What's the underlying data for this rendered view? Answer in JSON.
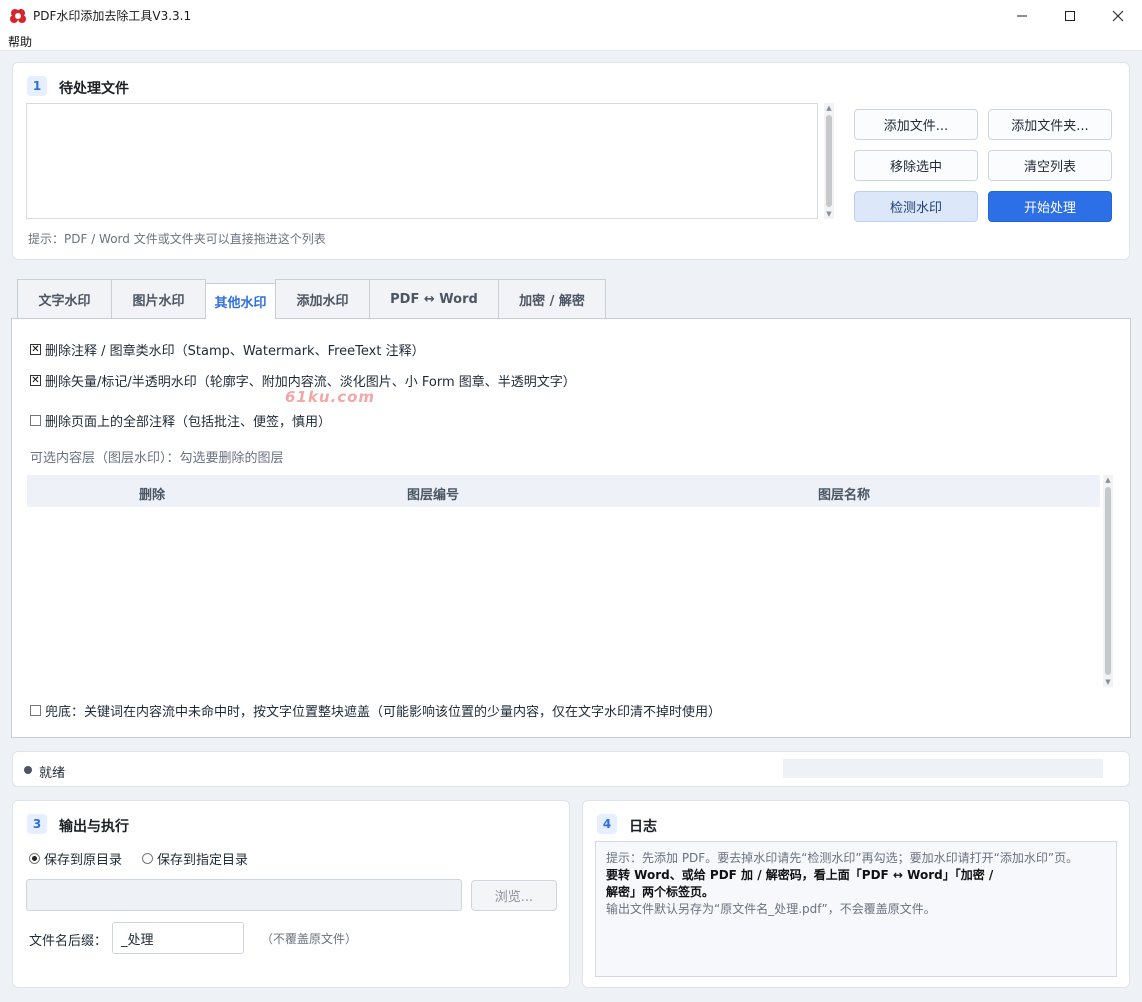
{
  "window": {
    "title": "PDF水印添加去除工具V3.3.1",
    "minimize": "—",
    "maximize": "☐",
    "close": "✕"
  },
  "menu": {
    "help": "帮助"
  },
  "files_section": {
    "number": "1",
    "title": "待处理文件",
    "hint": "提示：PDF / Word 文件或文件夹可以直接拖进这个列表",
    "buttons": {
      "add_file": "添加文件...",
      "add_folder": "添加文件夹...",
      "remove_selected": "移除选中",
      "clear_list": "清空列表",
      "detect_watermark": "检测水印",
      "start": "开始处理"
    }
  },
  "tabs": [
    "文字水印",
    "图片水印",
    "其他水印",
    "添加水印",
    "PDF ↔ Word",
    "加密 / 解密"
  ],
  "active_tab": 2,
  "other_watermark": {
    "opt_annotations": "删除注释 / 图章类水印（Stamp、Watermark、FreeText 注释）",
    "opt_annotations_checked": true,
    "opt_vector": "删除矢量/标记/半透明水印（轮廓字、附加内容流、淡化图片、小 Form 图章、半透明文字）",
    "opt_vector_checked": true,
    "opt_all_annots": "删除页面上的全部注释（包括批注、便签，慎用）",
    "opt_all_annots_checked": false,
    "layers_label": "可选内容层（图层水印）：勾选要删除的图层",
    "columns": [
      "删除",
      "图层编号",
      "图层名称"
    ],
    "rows": [],
    "fallback": "兜底：关键词在内容流中未命中时，按文字位置整块遮盖（可能影响该位置的少量内容，仅在文字水印清不掉时使用）",
    "fallback_checked": false
  },
  "watermark_logo": "61ku.com",
  "status": {
    "text": "就绪",
    "progress": 0
  },
  "output_section": {
    "number": "3",
    "title": "输出与执行",
    "save_original": "保存到原目录",
    "save_custom": "保存到指定目录",
    "save_mode": "original",
    "dir_value": "",
    "browse": "浏览...",
    "suffix_label": "文件名后缀：",
    "suffix_value": "_处理",
    "suffix_note": "（不覆盖原文件）"
  },
  "log_section": {
    "number": "4",
    "title": "日志",
    "line1": "提示：先添加 PDF。要去掉水印请先“检测水印”再勾选；要加水印请打开“添加水印”页。",
    "line2a": "要转 Word、或给 PDF 加 / 解密码，看上面「PDF ↔ Word」「加密 /",
    "line2b": "解密」两个标签页。",
    "line3": "输出文件默认另存为“原文件名_处理.pdf”，不会覆盖原文件。"
  },
  "colors": {
    "accent": "#2d6fe6",
    "detect_bg": "#dce8fa",
    "section_badge": "#e6efff"
  }
}
